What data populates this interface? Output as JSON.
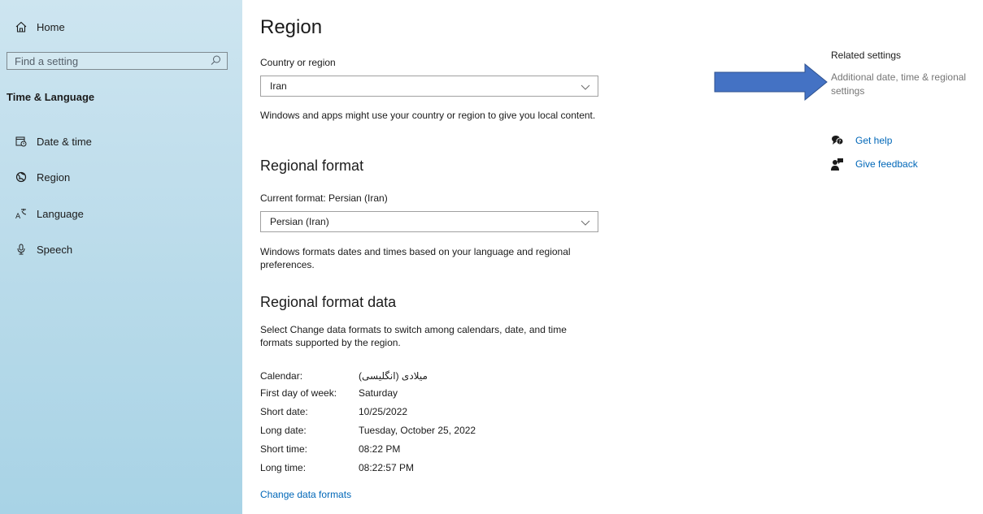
{
  "sidebar": {
    "home_label": "Home",
    "search_placeholder": "Find a setting",
    "section_title": "Time & Language",
    "items": [
      {
        "label": "Date & time",
        "icon": "calendar-clock-icon"
      },
      {
        "label": "Region",
        "icon": "globe-icon"
      },
      {
        "label": "Language",
        "icon": "language-icon"
      },
      {
        "label": "Speech",
        "icon": "microphone-icon"
      }
    ]
  },
  "main": {
    "title": "Region",
    "country": {
      "label": "Country or region",
      "value": "Iran",
      "description": "Windows and apps might use your country or region to give you local content."
    },
    "regional_format": {
      "heading": "Regional format",
      "current_label": "Current format: Persian (Iran)",
      "value": "Persian (Iran)",
      "description": "Windows formats dates and times based on your language and regional preferences."
    },
    "format_data": {
      "heading": "Regional format data",
      "description": "Select Change data formats to switch among calendars, date, and time formats supported by the region.",
      "rows": [
        {
          "key": "Calendar:",
          "value": "میلادی (انگلیسی)"
        },
        {
          "key": "First day of week:",
          "value": "Saturday"
        },
        {
          "key": "Short date:",
          "value": "10/25/2022"
        },
        {
          "key": "Long date:",
          "value": "Tuesday, October 25, 2022"
        },
        {
          "key": "Short time:",
          "value": "08:22 PM"
        },
        {
          "key": "Long time:",
          "value": "08:22:57 PM"
        }
      ],
      "change_link": "Change data formats"
    }
  },
  "right": {
    "related_title": "Related settings",
    "related_link": "Additional date, time & regional settings",
    "help_label": "Get help",
    "feedback_label": "Give feedback"
  },
  "colors": {
    "accent_link": "#0067b8",
    "arrow_fill": "#4472c4",
    "sidebar_bg": "#b8dbea"
  }
}
